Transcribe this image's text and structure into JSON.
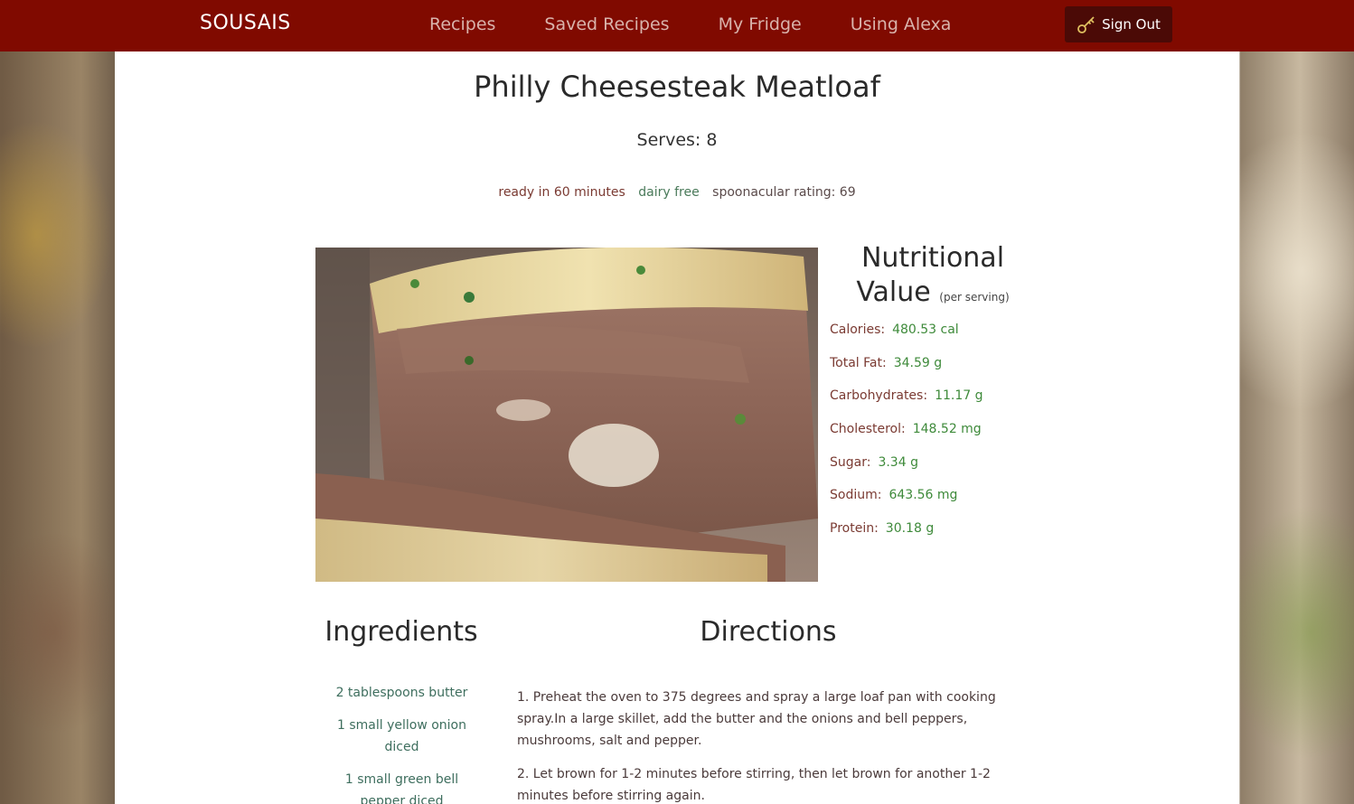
{
  "nav": {
    "brand": "SOUSAIS",
    "links": [
      "Recipes",
      "Saved Recipes",
      "My Fridge",
      "Using Alexa"
    ],
    "signout": "Sign Out"
  },
  "recipe": {
    "title": "Philly Cheesesteak Meatloaf",
    "serves": "Serves: 8",
    "ready": "ready in 60 minutes",
    "diet": "dairy free",
    "rating": "spoonacular rating: 69"
  },
  "nutrition": {
    "heading_line1": "Nutritional",
    "heading_line2": "Value",
    "per_serving": "(per serving)",
    "rows": [
      {
        "label": "Calories:",
        "value": "480.53 cal"
      },
      {
        "label": "Total Fat:",
        "value": "34.59 g"
      },
      {
        "label": "Carbohydrates:",
        "value": "11.17 g"
      },
      {
        "label": "Cholesterol:",
        "value": "148.52 mg"
      },
      {
        "label": "Sugar:",
        "value": "3.34 g"
      },
      {
        "label": "Sodium:",
        "value": "643.56 mg"
      },
      {
        "label": "Protein:",
        "value": "30.18 g"
      }
    ]
  },
  "ingredients": {
    "heading": "Ingredients",
    "items": [
      "2 tablespoons butter",
      "1 small yellow onion diced",
      "1 small green bell pepper diced"
    ]
  },
  "directions": {
    "heading": "Directions",
    "steps": [
      "1. Preheat the oven to 375 degrees and spray a large loaf pan with cooking spray.In a large skillet, add the butter and the onions and bell peppers, mushrooms, salt and pepper.",
      "2. Let brown for 1-2 minutes before stirring, then let brown for another 1-2 minutes before stirring again."
    ]
  },
  "colors": {
    "navbar": "#800a00",
    "signout_bg": "#4b0a06",
    "label": "#7a3a32",
    "value": "#3e8a3a"
  }
}
